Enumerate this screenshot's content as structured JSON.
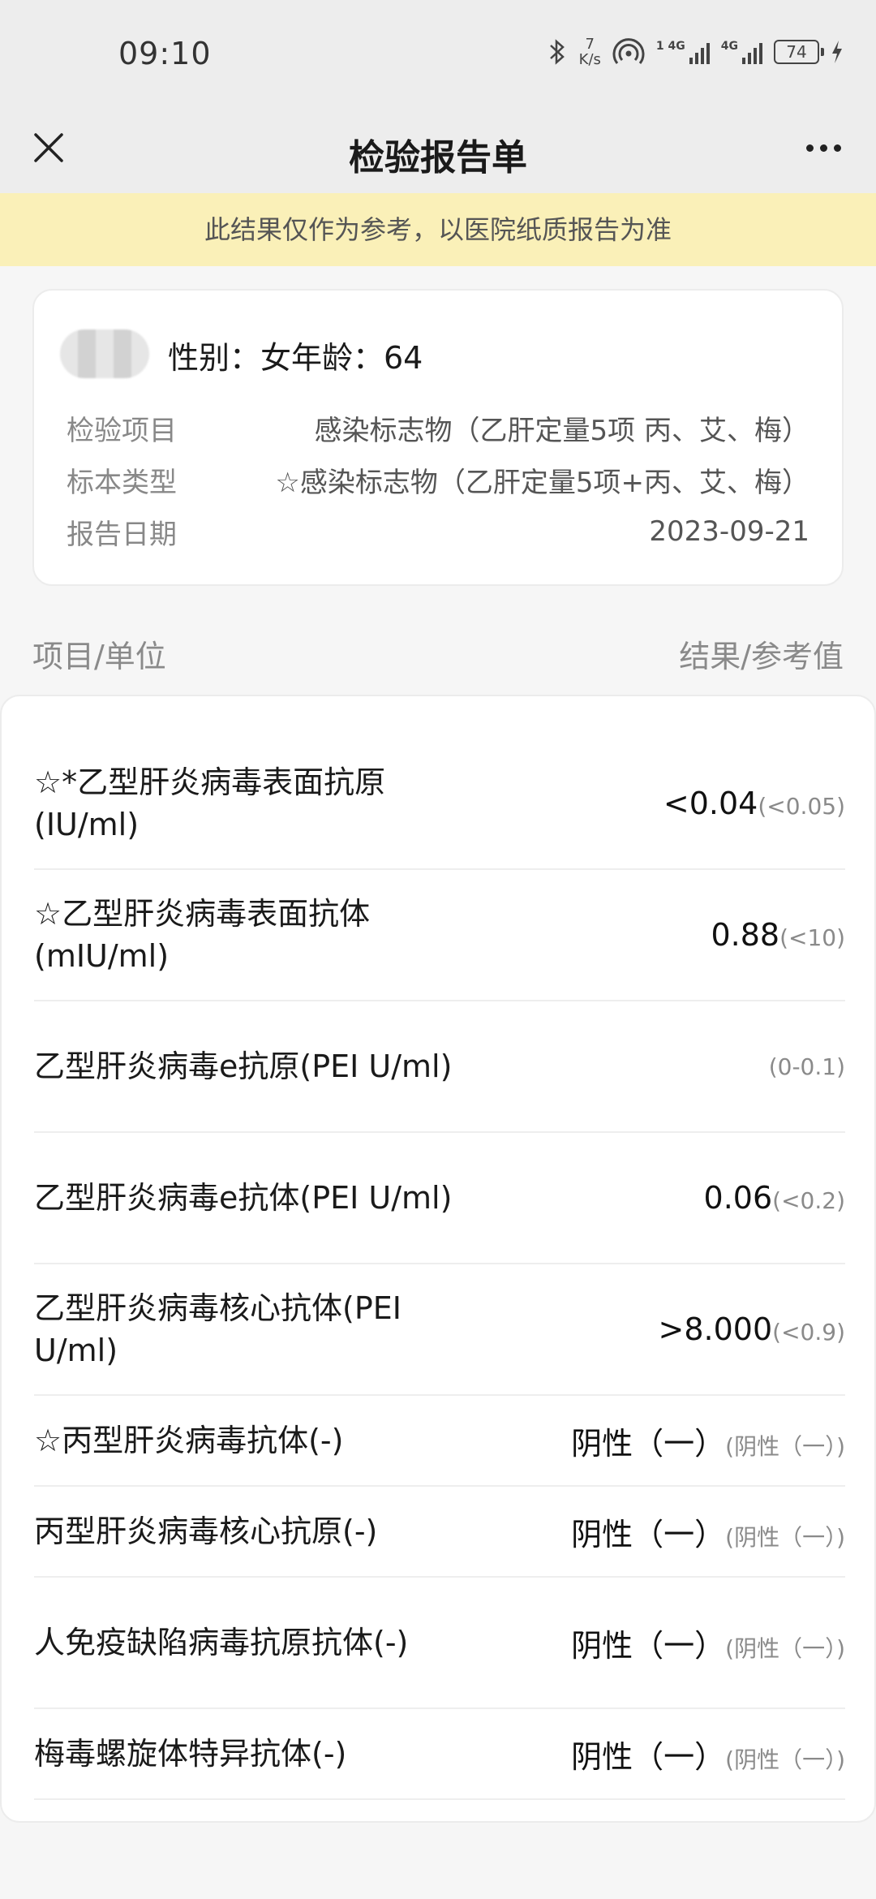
{
  "status_bar": {
    "time": "09:10",
    "speed_value": "7",
    "speed_unit": "K/s",
    "battery": "74",
    "icons": [
      "bluetooth-icon",
      "hotspot-icon",
      "signal-4g-icon",
      "signal-4g-icon",
      "battery-icon",
      "charging-icon"
    ]
  },
  "nav": {
    "title": "检验报告单",
    "close_icon": "close-icon",
    "more_icon": "more-icon"
  },
  "notice": "此结果仅作为参考，以医院纸质报告为准",
  "patient": {
    "gender_age": "性别：女年龄：64",
    "fields": [
      {
        "label": "检验项目",
        "value": "感染标志物（乙肝定量5项 丙、艾、梅）"
      },
      {
        "label": "标本类型",
        "value": "☆感染标志物（乙肝定量5项+丙、艾、梅）"
      },
      {
        "label": "报告日期",
        "value": "2023-09-21"
      }
    ]
  },
  "table": {
    "left_header": "项目/单位",
    "right_header": "结果/参考值",
    "rows": [
      {
        "name": "☆*乙型肝炎病毒表面抗原(IU/ml)",
        "value": "<0.04",
        "ref": "(<0.05)"
      },
      {
        "name": "☆乙型肝炎病毒表面抗体(mIU/ml)",
        "value": "0.88",
        "ref": "(<10)"
      },
      {
        "name": "乙型肝炎病毒e抗原(PEI U/ml)",
        "value": "",
        "ref": "(0-0.1)"
      },
      {
        "name": "乙型肝炎病毒e抗体(PEI U/ml)",
        "value": "0.06",
        "ref": "(<0.2)"
      },
      {
        "name": "乙型肝炎病毒核心抗体(PEI U/ml)",
        "value": ">8.000",
        "ref": "(<0.9)"
      },
      {
        "name": "☆丙型肝炎病毒抗体(-)",
        "value": "阴性（一）",
        "ref": "(阴性（一）)"
      },
      {
        "name": "丙型肝炎病毒核心抗原(-)",
        "value": "阴性（一）",
        "ref": "(阴性（一）)"
      },
      {
        "name": "人免疫缺陷病毒抗原抗体(-)",
        "value": "阴性（一）",
        "ref": "(阴性（一）)"
      },
      {
        "name": "梅毒螺旋体特异抗体(-)",
        "value": "阴性（一）",
        "ref": "(阴性（一）)"
      }
    ]
  }
}
